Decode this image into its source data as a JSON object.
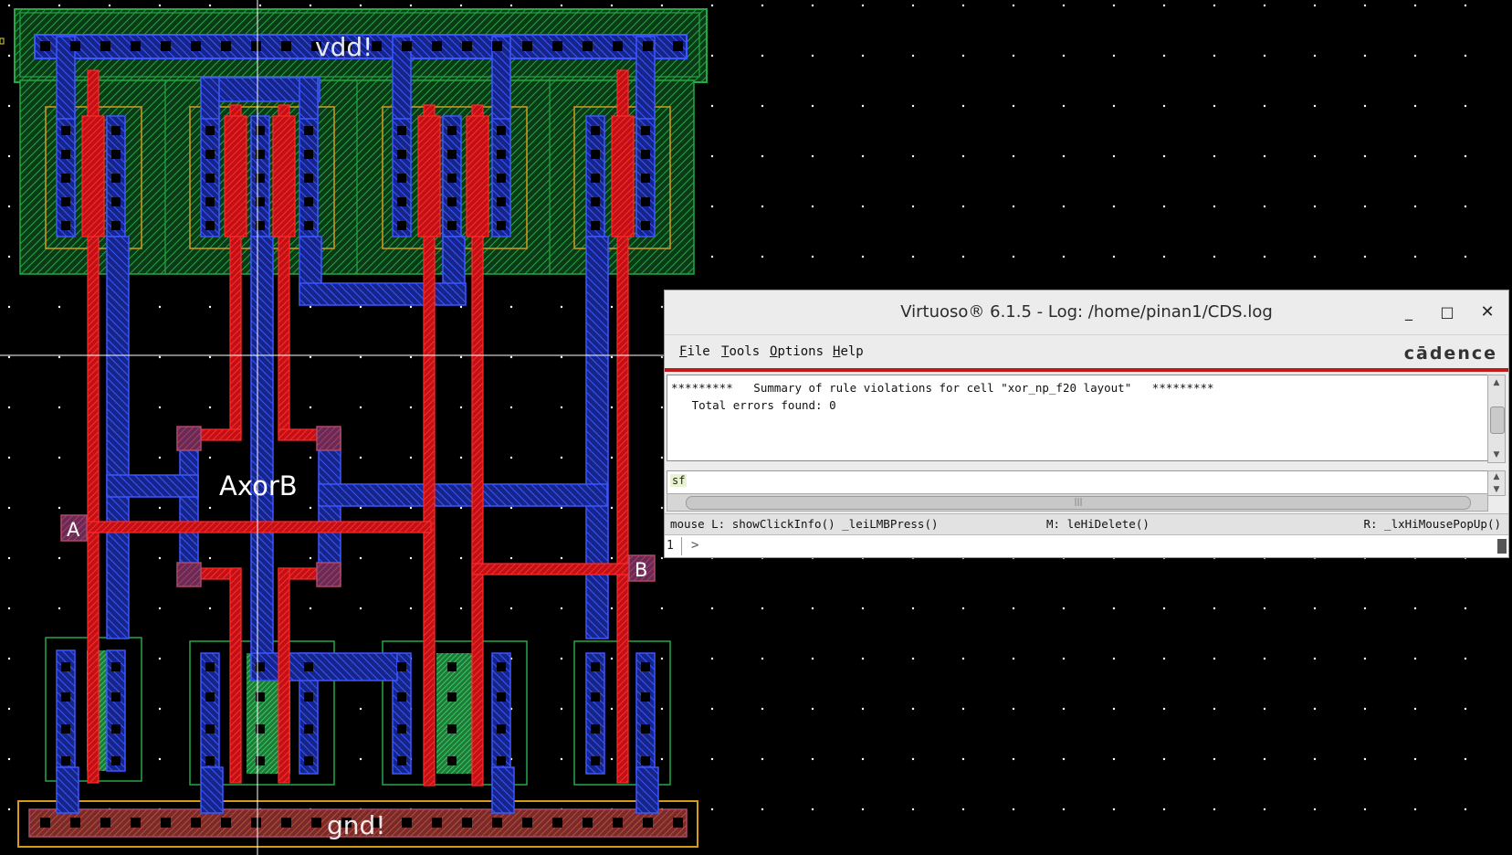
{
  "layout_canvas": {
    "pins": {
      "vdd": "vdd!",
      "gnd": "gnd!",
      "a": "A",
      "b": "B",
      "net": "AxorB"
    }
  },
  "log_window": {
    "title": "Virtuoso® 6.1.5 - Log: /home/pinan1/CDS.log",
    "controls": {
      "minimize": "_",
      "maximize": "□",
      "close": "✕"
    },
    "menu": [
      {
        "label": "File",
        "mnemonic": "F",
        "rest": "ile"
      },
      {
        "label": "Tools",
        "mnemonic": "T",
        "rest": "ools"
      },
      {
        "label": "Options",
        "mnemonic": "O",
        "rest": "ptions"
      },
      {
        "label": "Help",
        "mnemonic": "H",
        "rest": "elp"
      }
    ],
    "brand": "cādence",
    "log_lines": [
      "*********   Summary of rule violations for cell \"xor_np_f20 layout\"   *********",
      "   Total errors found: 0"
    ],
    "command_input": "sf",
    "status": {
      "left": "mouse L: showClickInfo() _leiLMBPress()",
      "middle": "M: leHiDelete()",
      "right": "R: _lxHiMousePopUp()"
    },
    "prompt_line": "1",
    "prompt_char": ">"
  },
  "colors": {
    "background": "#000000",
    "poly": "#e0161b",
    "metal1": "#2036e0",
    "nwell": "#22a845",
    "diffusion": "#b0486a",
    "implant": "#d69a1a",
    "crosshair": "#ffffff",
    "brand_red": "#c01a1a"
  }
}
